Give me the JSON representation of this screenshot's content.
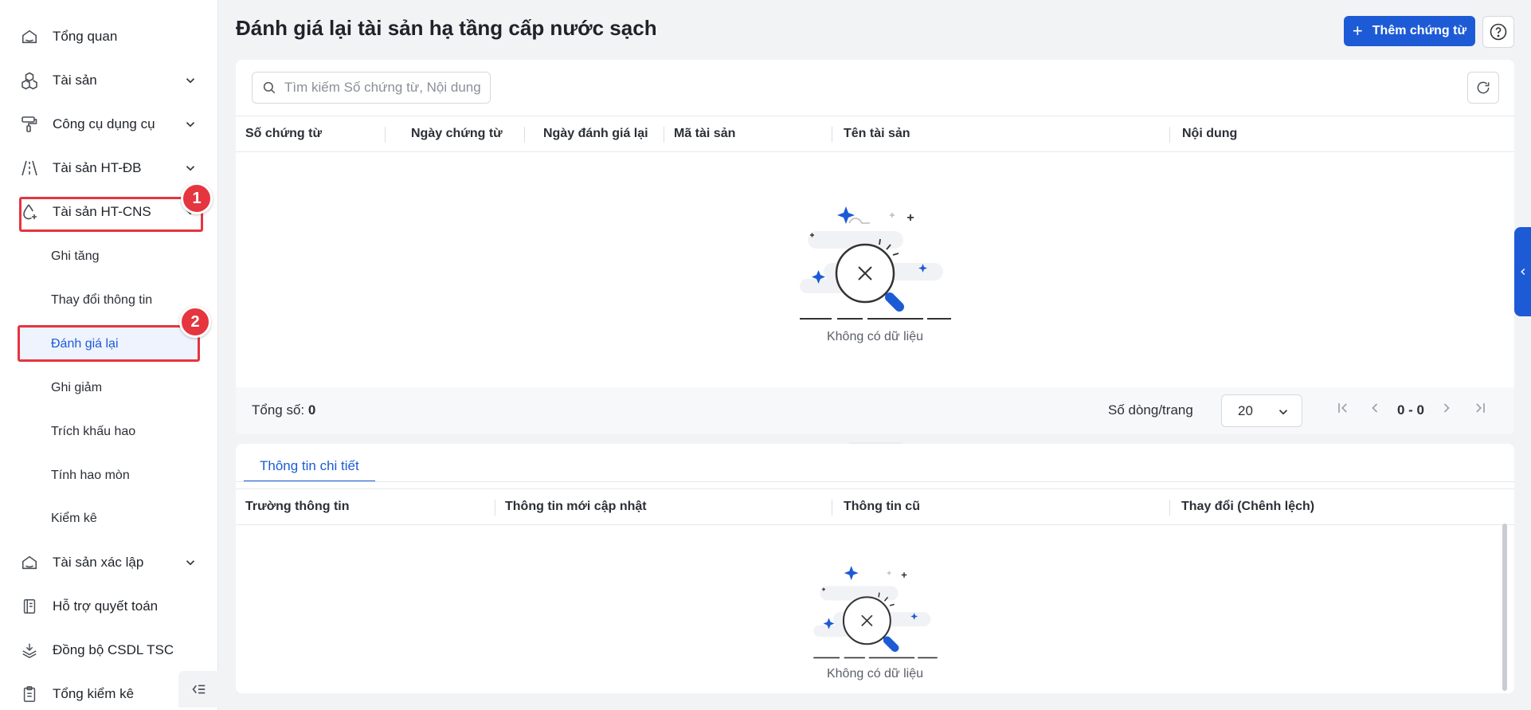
{
  "sidebar": {
    "items": [
      {
        "label": "Tổng quan",
        "icon": "home-icon"
      },
      {
        "label": "Tài sản",
        "icon": "cubes-icon"
      },
      {
        "label": "Công cụ dụng cụ",
        "icon": "paint-roller-icon"
      },
      {
        "label": "Tài sản HT-ĐB",
        "icon": "road-icon"
      },
      {
        "label": "Tài sản HT-CNS",
        "icon": "water-drop-icon"
      },
      {
        "label": "Tài sản xác lập",
        "icon": "home-icon"
      },
      {
        "label": "Hỗ trợ quyết toán",
        "icon": "ledger-icon"
      },
      {
        "label": "Đồng bộ CSDL TSC",
        "icon": "layers-icon"
      },
      {
        "label": "Tổng kiểm kê",
        "icon": "clipboard-icon"
      }
    ],
    "sub_items": [
      {
        "label": "Ghi tăng"
      },
      {
        "label": "Thay đổi thông tin"
      },
      {
        "label": "Đánh giá lại"
      },
      {
        "label": "Ghi giảm"
      },
      {
        "label": "Trích khấu hao"
      },
      {
        "label": "Tính hao mòn"
      },
      {
        "label": "Kiểm kê"
      }
    ],
    "active_sub": "Đánh giá lại"
  },
  "annotations": {
    "badge1": "1",
    "badge2": "2"
  },
  "header": {
    "title": "Đánh giá lại tài sản hạ tầng cấp nước sạch",
    "add_button_label": "Thêm chứng từ"
  },
  "list": {
    "search_placeholder": "Tìm kiếm Số chứng từ, Nội dung",
    "columns": [
      "Số chứng từ",
      "Ngày chứng từ",
      "Ngày đánh giá lại",
      "Mã tài sản",
      "Tên tài sản",
      "Nội dung"
    ],
    "empty_text": "Không có dữ liệu",
    "total_label": "Tổng số:",
    "total_value": "0",
    "rows_per_page_label": "Số dòng/trang",
    "rows_per_page_value": "20",
    "page_range": "0 - 0"
  },
  "detail": {
    "tab_label": "Thông tin chi tiết",
    "columns": [
      "Trường thông tin",
      "Thông tin mới cập nhật",
      "Thông tin cũ",
      "Thay đổi (Chênh lệch)"
    ],
    "empty_text": "Không có dữ liệu"
  },
  "colors": {
    "accent": "#1d5bd6",
    "highlight": "#e5353f"
  }
}
